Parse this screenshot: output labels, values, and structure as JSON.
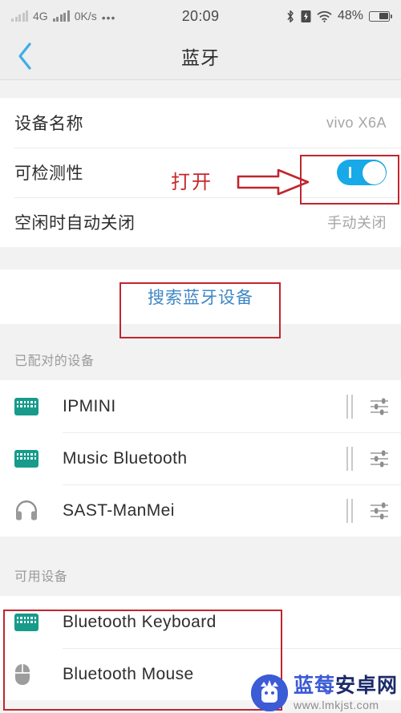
{
  "status_bar": {
    "network_label": "4G",
    "data_rate": "0K/s",
    "overflow_dots": "•••",
    "time": "20:09",
    "battery_percent": "48%",
    "icons": [
      "signal-bars-dim",
      "signal-bars",
      "bluetooth-icon",
      "charging-icon",
      "wifi-icon",
      "battery-icon"
    ]
  },
  "nav": {
    "back_icon": "chevron-left-icon",
    "title": "蓝牙"
  },
  "settings": {
    "device_name": {
      "label": "设备名称",
      "value": "vivo X6A"
    },
    "detectability": {
      "label": "可检测性",
      "toggle_state": "on"
    },
    "auto_off": {
      "label": "空闲时自动关闭",
      "value": "手动关闭"
    }
  },
  "search_action": {
    "label": "搜索蓝牙设备"
  },
  "paired_section": {
    "header": "已配对的设备",
    "devices": [
      {
        "name": "IPMINI",
        "icon": "keyboard-icon",
        "settings_icon": "sliders-icon"
      },
      {
        "name": "Music Bluetooth",
        "icon": "keyboard-icon",
        "settings_icon": "sliders-icon"
      },
      {
        "name": "SAST-ManMei",
        "icon": "headphones-icon",
        "settings_icon": "sliders-icon"
      }
    ]
  },
  "available_section": {
    "header": "可用设备",
    "devices": [
      {
        "name": "Bluetooth  Keyboard",
        "icon": "keyboard-icon"
      },
      {
        "name": "Bluetooth Mouse",
        "icon": "mouse-icon"
      }
    ]
  },
  "annotations": {
    "open_note": "打开",
    "arrow_icon": "arrow-right-outline-icon",
    "accent_color": "#c0262f"
  },
  "watermark": {
    "brand_blue": "蓝莓",
    "brand_dark": "安卓网",
    "url": "www.lmkjst.com",
    "logo_icon": "android-mascot-icon"
  },
  "colors": {
    "toggle_on": "#17a9e8",
    "link_blue": "#3f87c4",
    "keyboard_teal": "#179b8b",
    "annotation_red": "#c0262f"
  }
}
